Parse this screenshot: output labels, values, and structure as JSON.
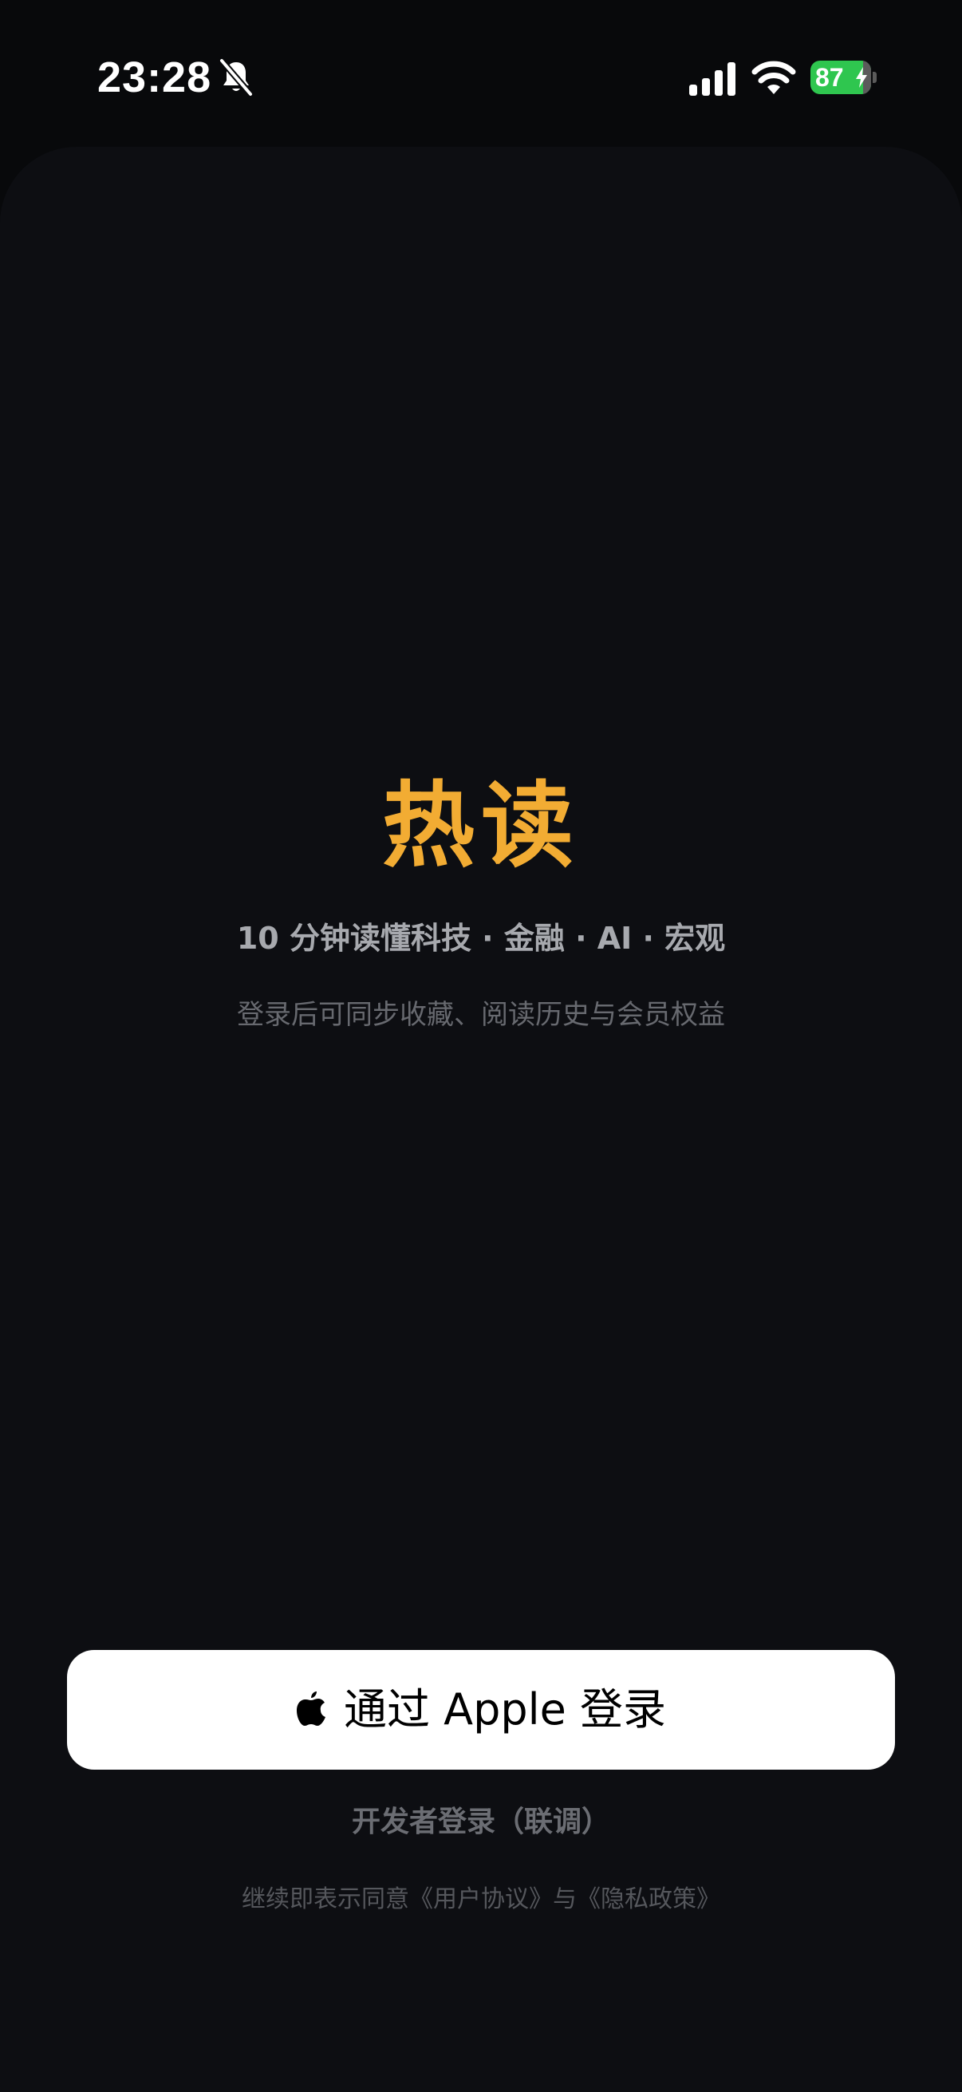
{
  "status_bar": {
    "time": "23:28",
    "battery_percent": "87",
    "battery_level": 0.87,
    "icons": [
      "bell-slash-icon",
      "cellular-signal-icon",
      "wifi-icon",
      "battery-charging-icon"
    ],
    "colors": {
      "battery_fill": "#2fc64f"
    }
  },
  "main": {
    "title": "热读",
    "tagline": "10 分钟读懂科技 · 金融 · AI · 宏观",
    "subtitle": "登录后可同步收藏、阅读历史与会员权益"
  },
  "actions": {
    "apple_login_label": "通过 Apple 登录",
    "apple_login_icon": "apple-logo-icon",
    "dev_login_label": "开发者登录（联调）"
  },
  "footer": {
    "agreement_text": "继续即表示同意《用户协议》与《隐私政策》"
  },
  "colors": {
    "background": "#08090b",
    "sheet": "#0d0e12",
    "accent": "#f2ac33",
    "button_bg": "#ffffff"
  }
}
